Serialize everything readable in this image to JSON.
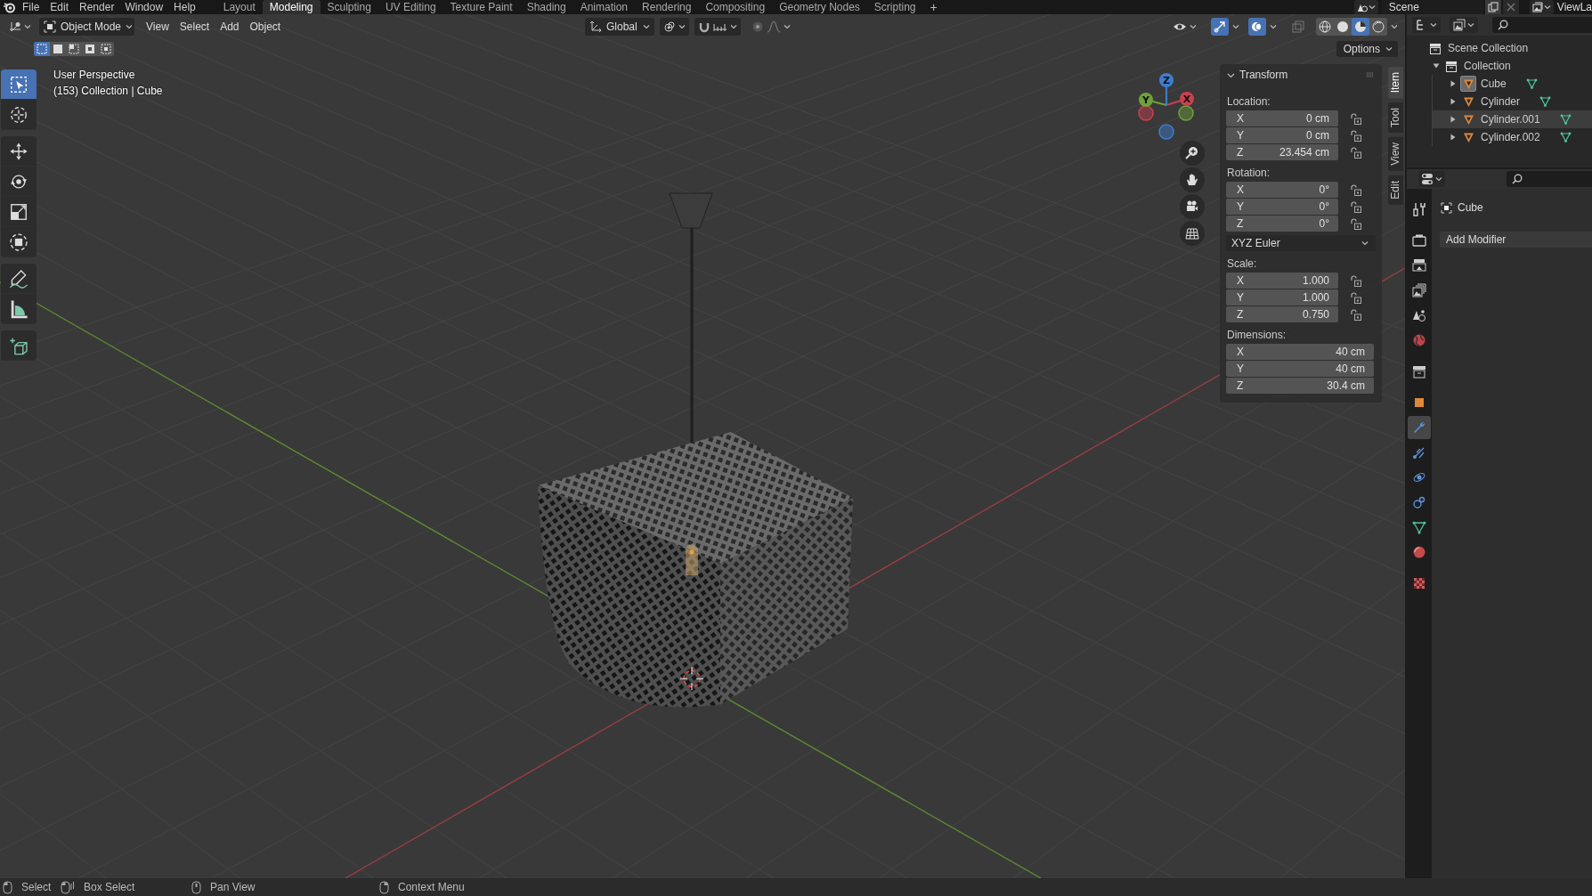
{
  "top_bar": {
    "menus": [
      "File",
      "Edit",
      "Render",
      "Window",
      "Help"
    ],
    "workspaces": [
      {
        "label": "Layout",
        "selected": false
      },
      {
        "label": "Modeling",
        "selected": true
      },
      {
        "label": "Sculpting",
        "selected": false
      },
      {
        "label": "UV Editing",
        "selected": false
      },
      {
        "label": "Texture Paint",
        "selected": false
      },
      {
        "label": "Shading",
        "selected": false
      },
      {
        "label": "Animation",
        "selected": false
      },
      {
        "label": "Rendering",
        "selected": false
      },
      {
        "label": "Compositing",
        "selected": false
      },
      {
        "label": "Geometry Nodes",
        "selected": false
      },
      {
        "label": "Scripting",
        "selected": false
      }
    ],
    "add_workspace": "+",
    "scene": "Scene",
    "view_layer": "ViewLa"
  },
  "viewport_header": {
    "mode": "Object Mode",
    "menus": [
      "View",
      "Select",
      "Add",
      "Object"
    ],
    "orientation": "Global",
    "gizmos_on": true,
    "overlays_on": true,
    "xray_on": false,
    "shading_modes": [
      {
        "kind": "wireframe",
        "selected": false
      },
      {
        "kind": "solid",
        "selected": false
      },
      {
        "kind": "material",
        "selected": true
      },
      {
        "kind": "rendered",
        "selected": false
      }
    ],
    "select_modes": [
      {
        "selected": true
      },
      {
        "selected": false
      },
      {
        "selected": false
      },
      {
        "selected": false
      },
      {
        "selected": false
      }
    ],
    "options_button": "Options"
  },
  "viewport": {
    "view_name": "User Perspective",
    "object_info": "(153) Collection | Cube",
    "tool_groups": [
      {
        "tools": [
          {
            "kind": "select_box",
            "selected": true
          },
          {
            "kind": "cursor",
            "selected": false
          }
        ]
      },
      {
        "tools": [
          {
            "kind": "move",
            "selected": false
          },
          {
            "kind": "rotate",
            "selected": false
          },
          {
            "kind": "scale",
            "selected": false
          },
          {
            "kind": "transform",
            "selected": false
          }
        ]
      },
      {
        "tools": [
          {
            "kind": "annotate",
            "selected": false
          },
          {
            "kind": "measure",
            "selected": false
          }
        ]
      },
      {
        "tools": [
          {
            "kind": "add_cube",
            "selected": false
          }
        ]
      }
    ],
    "gizmo_axes": [
      {
        "label": "X"
      },
      {
        "label": "Y"
      },
      {
        "label": "Z"
      }
    ]
  },
  "sidebar": {
    "tabs": [
      {
        "label": "Item",
        "selected": true
      },
      {
        "label": "Tool",
        "selected": false
      },
      {
        "label": "View",
        "selected": false
      },
      {
        "label": "Edit",
        "selected": false
      }
    ],
    "panel": {
      "title": "Transform",
      "expanded": true,
      "sections": [
        {
          "kind": "locked_vector",
          "label": "Location:",
          "rows": [
            {
              "axis": "X",
              "value": "0 cm",
              "locked": false
            },
            {
              "axis": "Y",
              "value": "0 cm",
              "locked": false
            },
            {
              "axis": "Z",
              "value": "23.454 cm",
              "locked": false
            }
          ]
        },
        {
          "kind": "locked_vector",
          "label": "Rotation:",
          "rows": [
            {
              "axis": "X",
              "value": "0°",
              "locked": false
            },
            {
              "axis": "Y",
              "value": "0°",
              "locked": false
            },
            {
              "axis": "Z",
              "value": "0°",
              "locked": false
            }
          ],
          "mode": "XYZ Euler"
        },
        {
          "kind": "locked_vector",
          "label": "Scale:",
          "rows": [
            {
              "axis": "X",
              "value": "1.000",
              "locked": false
            },
            {
              "axis": "Y",
              "value": "1.000",
              "locked": false
            },
            {
              "axis": "Z",
              "value": "0.750",
              "locked": false
            }
          ]
        },
        {
          "kind": "vector",
          "label": "Dimensions:",
          "rows": [
            {
              "axis": "X",
              "value": "40 cm"
            },
            {
              "axis": "Y",
              "value": "40 cm"
            },
            {
              "axis": "Z",
              "value": "30.4 cm"
            }
          ]
        }
      ]
    }
  },
  "outliner": {
    "tree": [
      {
        "name": "Scene Collection",
        "kind": "scene_collection",
        "selected": false,
        "children": [
          {
            "name": "Collection",
            "kind": "collection",
            "selected": false,
            "expanded": true,
            "children": [
              {
                "name": "Cube",
                "kind": "mesh_object",
                "selected": false,
                "expanded": false,
                "active": true,
                "hovered": false
              },
              {
                "name": "Cylinder",
                "kind": "mesh_object",
                "selected": false,
                "expanded": false,
                "active": false,
                "hovered": false
              },
              {
                "name": "Cylinder.001",
                "kind": "mesh_object",
                "selected": false,
                "expanded": false,
                "active": false,
                "hovered": true
              },
              {
                "name": "Cylinder.002",
                "kind": "mesh_object",
                "selected": false,
                "expanded": false,
                "active": false,
                "hovered": false
              }
            ]
          }
        ]
      }
    ]
  },
  "properties": {
    "tabs": [
      {
        "kind": "tool",
        "selected": false
      },
      {
        "kind": "render",
        "selected": false
      },
      {
        "kind": "output",
        "selected": false
      },
      {
        "kind": "view_layer",
        "selected": false
      },
      {
        "kind": "scene",
        "selected": false
      },
      {
        "kind": "world",
        "selected": false
      },
      {
        "kind": "collection",
        "selected": false
      },
      {
        "kind": "object",
        "selected": false
      },
      {
        "kind": "modifier",
        "selected": true
      },
      {
        "kind": "particles",
        "selected": false
      },
      {
        "kind": "physics",
        "selected": false
      },
      {
        "kind": "constraints",
        "selected": false
      },
      {
        "kind": "data",
        "selected": false
      },
      {
        "kind": "material",
        "selected": false
      },
      {
        "kind": "texture",
        "selected": false
      }
    ],
    "object_name": "Cube",
    "add_modifier": "Add Modifier"
  },
  "status_bar": {
    "hints": [
      {
        "kind": "left_click",
        "label": "Select"
      },
      {
        "kind": "left_drag",
        "label": "Box Select"
      },
      {
        "kind": "middle_click",
        "label": "Pan View"
      },
      {
        "kind": "right_click",
        "label": "Context Menu"
      }
    ]
  }
}
